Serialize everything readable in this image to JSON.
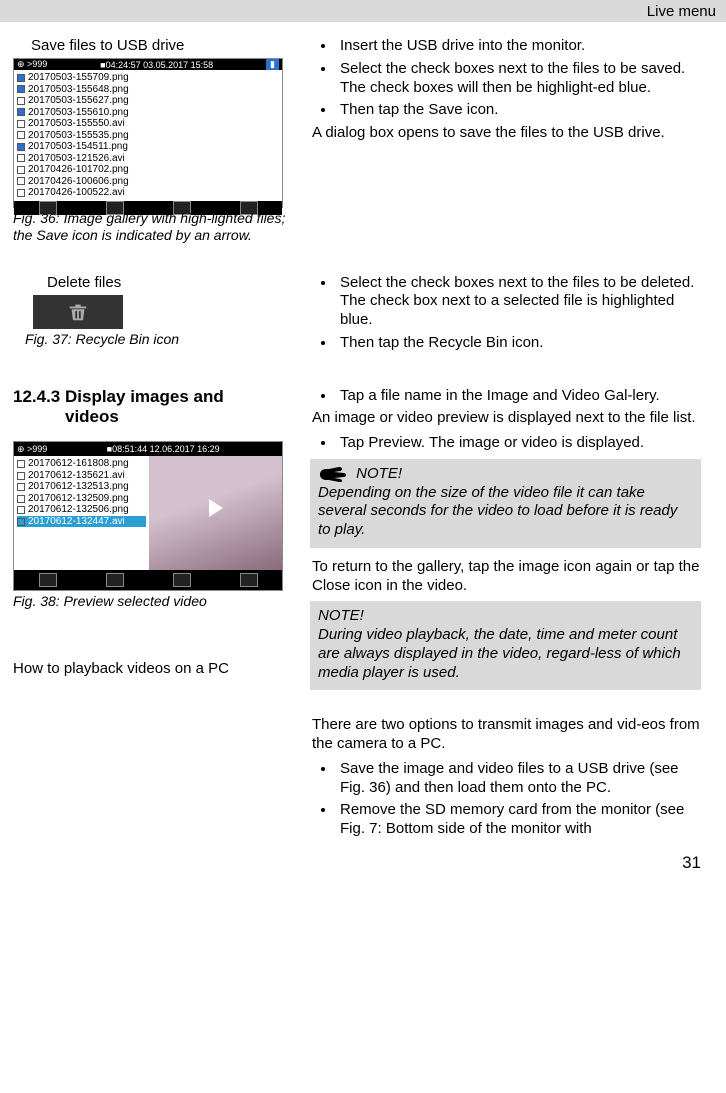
{
  "header": {
    "right": "Live menu"
  },
  "sec1": {
    "left_title": "Save files to USB drive",
    "fig36_status": {
      "left": "⊕ >999",
      "mid": "■04:24:57  03.05.2017  15:58",
      "right": "▮"
    },
    "fig36_files": [
      {
        "sel": true,
        "name": "20170503-155709.png"
      },
      {
        "sel": true,
        "name": "20170503-155648.png"
      },
      {
        "sel": false,
        "name": "20170503-155627.png"
      },
      {
        "sel": true,
        "name": "20170503-155610.png"
      },
      {
        "sel": false,
        "name": "20170503-155550.avi"
      },
      {
        "sel": false,
        "name": "20170503-155535.png"
      },
      {
        "sel": true,
        "name": "20170503-154511.png"
      },
      {
        "sel": false,
        "name": "20170503-121526.avi"
      },
      {
        "sel": false,
        "name": "20170426-101702.png"
      },
      {
        "sel": false,
        "name": "20170426-100606.png"
      },
      {
        "sel": false,
        "name": "20170426-100522.avi"
      }
    ],
    "fig36_caption": "Fig. 36: Image gallery with high-lighted files; the Save icon is indicated by an arrow.",
    "bullets": [
      "Insert the USB drive into the monitor.",
      "Select the check boxes next to the files to be saved. The check boxes will then be highlight-ed blue.",
      "Then tap the Save icon."
    ],
    "after": "A dialog box opens to save the files to the USB drive."
  },
  "sec2": {
    "left_title": "Delete files",
    "fig37_caption": "Fig. 37: Recycle Bin icon",
    "bullets": [
      "Select the check boxes next to the files to be deleted. The check box next to a selected file is highlighted blue.",
      "Then tap the Recycle Bin icon."
    ]
  },
  "sec3": {
    "heading_num": "12.4.3",
    "heading_text": "Display images and videos",
    "fig38_status": {
      "left": "⊕ >999",
      "mid": "■08:51:44  12.06.2017  16:29",
      "right": ""
    },
    "fig38_files": [
      {
        "sel": false,
        "hl": false,
        "name": "20170612-161808.png"
      },
      {
        "sel": false,
        "hl": false,
        "name": "20170612-135621.avi"
      },
      {
        "sel": false,
        "hl": false,
        "name": "20170612-132513.png"
      },
      {
        "sel": false,
        "hl": false,
        "name": "20170612-132509.png"
      },
      {
        "sel": false,
        "hl": false,
        "name": "20170612-132506.png"
      },
      {
        "sel": false,
        "hl": true,
        "name": "20170612-132447.avi"
      }
    ],
    "fig38_caption": "Fig. 38: Preview selected video",
    "bullets_a": [
      "Tap a file name in the Image and Video Gal-lery."
    ],
    "after_a": "An image or video preview is displayed next to the file list.",
    "bullets_b": [
      "Tap Preview. The image or video is displayed."
    ],
    "note1_label": "NOTE!",
    "note1_body": "Depending on the size of the video file it can take several seconds for the video to load before it is ready to play.",
    "after_note1": "To return to the gallery, tap the image icon again or tap the Close icon in the video.",
    "left_text2": "How to playback videos on a PC",
    "note2_label": "NOTE!",
    "note2_body": "During video playback, the date, time and meter count are always displayed in the video, regard-less of which media player is used.",
    "after_note2": "There are two options to transmit images and vid-eos from the camera to a PC.",
    "bullets_c": [
      "Save the image and video files to a USB drive (see Fig. 36) and then load them onto the PC.",
      "Remove the SD memory card from the monitor (see Fig. 7: Bottom side of the monitor with"
    ]
  },
  "page_number": "31"
}
